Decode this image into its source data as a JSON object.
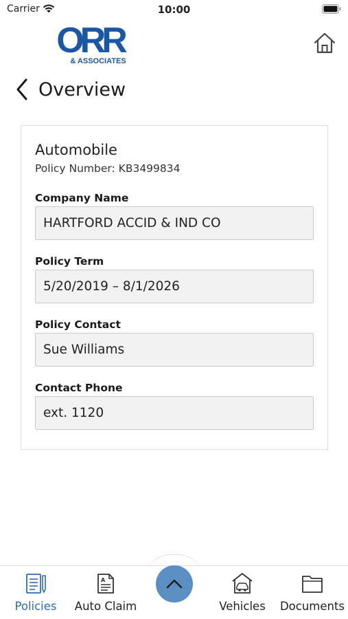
{
  "status_bar": {
    "carrier": "Carrier",
    "time": "10:00"
  },
  "header": {
    "logo_text": "ORR",
    "logo_subtext": "& ASSOCIATES",
    "brand_color": "#1b57a3",
    "home_icon": "home-icon"
  },
  "nav": {
    "back_icon": "chevron-left-icon",
    "title": "Overview"
  },
  "policy": {
    "type": "Automobile",
    "policy_number": "Policy Number: KB3499834",
    "fields": [
      {
        "label": "Company Name",
        "value": "HARTFORD ACCID & IND CO"
      },
      {
        "label": "Policy Term",
        "value": "5/20/2019 – 8/1/2026"
      },
      {
        "label": "Policy Contact",
        "value": "Sue Williams"
      },
      {
        "label": "Contact Phone",
        "value": "ext. 1120"
      }
    ]
  },
  "tab_bar": {
    "active_color": "#2e6dad",
    "fab_color": "#5b8fc4",
    "fab_icon": "chevron-up-icon",
    "tabs": [
      {
        "label": "Policies",
        "icon": "policies-icon",
        "active": true
      },
      {
        "label": "Auto Claim",
        "icon": "auto-claim-icon",
        "active": false
      },
      {
        "label": "Vehicles",
        "icon": "vehicles-icon",
        "active": false
      },
      {
        "label": "Documents",
        "icon": "documents-icon",
        "active": false
      }
    ]
  }
}
